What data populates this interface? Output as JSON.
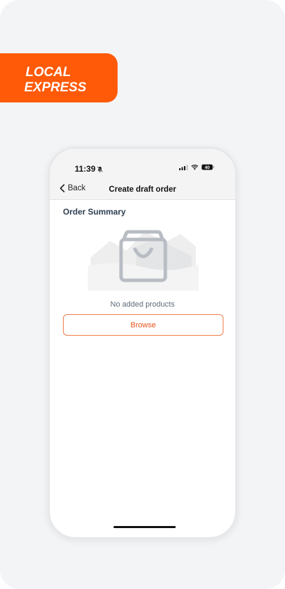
{
  "brand": {
    "line1": "LOCAL",
    "line2": "EXPRESS",
    "color": "#fe5a08"
  },
  "status_bar": {
    "time": "11:39",
    "battery": "40",
    "icons": [
      "bell-slash-icon",
      "signal-icon",
      "wifi-icon",
      "battery-icon"
    ]
  },
  "nav": {
    "back_label": "Back",
    "title": "Create draft order"
  },
  "order_summary": {
    "title": "Order Summary",
    "empty_icon": "shopping-bag-icon",
    "empty_text": "No added products",
    "browse_label": "Browse",
    "accent": "#e8541c"
  }
}
